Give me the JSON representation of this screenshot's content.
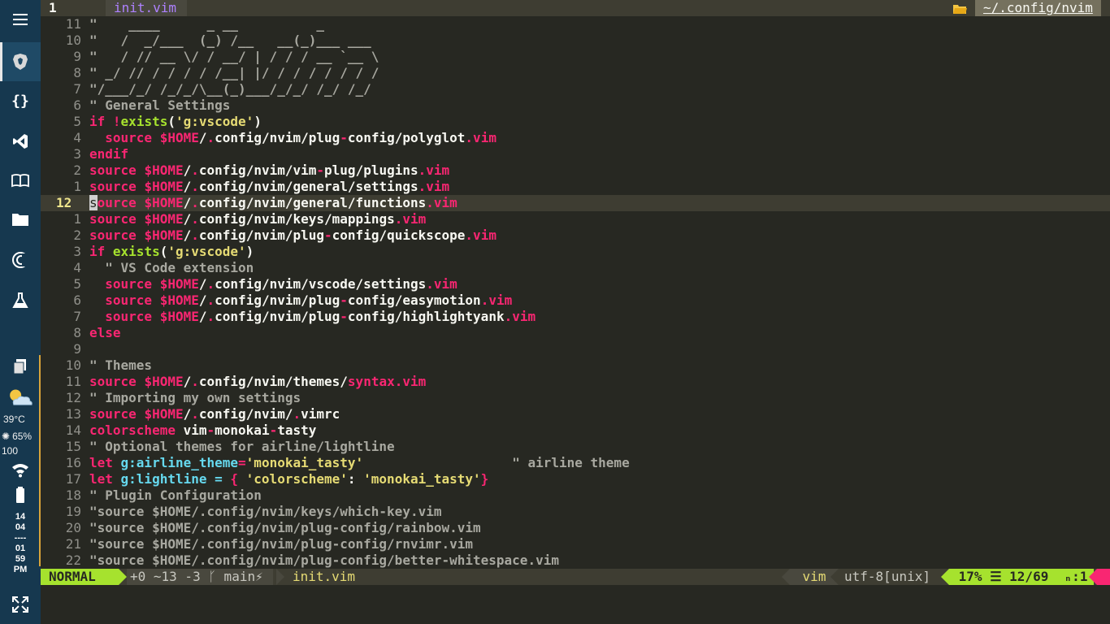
{
  "dock": {
    "weather_temp": "39°C",
    "brightness": "65%",
    "volume": "100",
    "clock": [
      "14",
      "04",
      "----",
      "01",
      "59",
      "PM"
    ]
  },
  "tabline": {
    "tab_number": "1",
    "active_tab": "init.vim",
    "cwd": "~/.config/nvim"
  },
  "buffer": {
    "lines": [
      {
        "n": "11",
        "segs": [
          [
            "c",
            "\"    ____      _ __          _"
          ]
        ]
      },
      {
        "n": "10",
        "segs": [
          [
            "c",
            "\"   /  _/___  (_) /__   __(_)___ ___"
          ]
        ]
      },
      {
        "n": "9",
        "segs": [
          [
            "c",
            "\"   / // __ \\/ / __/ | / / / __ `__ \\"
          ]
        ]
      },
      {
        "n": "8",
        "segs": [
          [
            "c",
            "\" _/ // / / / / /__| |/ / / / / / / /"
          ]
        ]
      },
      {
        "n": "7",
        "segs": [
          [
            "c",
            "\"/___/_/ /_/_/\\__(_)___/_/_/ /_/ /_/"
          ]
        ]
      },
      {
        "n": "6",
        "segs": [
          [
            "c",
            "\" General Settings"
          ]
        ]
      },
      {
        "n": "5",
        "segs": [
          [
            "k",
            "if "
          ],
          [
            "k",
            "!"
          ],
          [
            "fn",
            "exists"
          ],
          [
            "w",
            "("
          ],
          [
            "s",
            "'g:vscode'"
          ],
          [
            "w",
            ")"
          ]
        ]
      },
      {
        "n": "4",
        "segs": [
          [
            "k",
            "  source "
          ],
          [
            "v",
            "$HOME"
          ],
          [
            "p",
            "/"
          ],
          [
            "k",
            "."
          ],
          [
            "p",
            "config/nvim/plug"
          ],
          [
            "k",
            "-"
          ],
          [
            "p",
            "config/polyglot"
          ],
          [
            "k",
            ".vim"
          ]
        ]
      },
      {
        "n": "3",
        "segs": [
          [
            "k",
            "endif"
          ]
        ]
      },
      {
        "n": "2",
        "segs": [
          [
            "k",
            "source "
          ],
          [
            "v",
            "$HOME"
          ],
          [
            "p",
            "/"
          ],
          [
            "k",
            "."
          ],
          [
            "p",
            "config/nvim/vim"
          ],
          [
            "k",
            "-"
          ],
          [
            "p",
            "plug/plugins"
          ],
          [
            "k",
            ".vim"
          ]
        ]
      },
      {
        "n": "1",
        "segs": [
          [
            "k",
            "source "
          ],
          [
            "v",
            "$HOME"
          ],
          [
            "p",
            "/"
          ],
          [
            "k",
            "."
          ],
          [
            "p",
            "config/nvim/general/settings"
          ],
          [
            "k",
            ".vim"
          ]
        ]
      },
      {
        "n": "12",
        "cur": true,
        "segs": [
          [
            "cursor",
            "s"
          ],
          [
            "k",
            "ource "
          ],
          [
            "v",
            "$HOME"
          ],
          [
            "p",
            "/"
          ],
          [
            "k",
            "."
          ],
          [
            "p",
            "config/nvim/general/functions"
          ],
          [
            "k",
            ".vim"
          ]
        ]
      },
      {
        "n": "1",
        "segs": [
          [
            "k",
            "source "
          ],
          [
            "v",
            "$HOME"
          ],
          [
            "p",
            "/"
          ],
          [
            "k",
            "."
          ],
          [
            "p",
            "config/nvim/keys/mappings"
          ],
          [
            "k",
            ".vim"
          ]
        ]
      },
      {
        "n": "2",
        "segs": [
          [
            "k",
            "source "
          ],
          [
            "v",
            "$HOME"
          ],
          [
            "p",
            "/"
          ],
          [
            "k",
            "."
          ],
          [
            "p",
            "config/nvim/plug"
          ],
          [
            "k",
            "-"
          ],
          [
            "p",
            "config/quickscope"
          ],
          [
            "k",
            ".vim"
          ]
        ]
      },
      {
        "n": "3",
        "segs": [
          [
            "k",
            "if "
          ],
          [
            "fn",
            "exists"
          ],
          [
            "w",
            "("
          ],
          [
            "s",
            "'g:vscode'"
          ],
          [
            "w",
            ")"
          ]
        ]
      },
      {
        "n": "4",
        "segs": [
          [
            "c",
            "  \" VS Code extension"
          ]
        ]
      },
      {
        "n": "5",
        "segs": [
          [
            "k",
            "  source "
          ],
          [
            "v",
            "$HOME"
          ],
          [
            "p",
            "/"
          ],
          [
            "k",
            "."
          ],
          [
            "p",
            "config/nvim/vscode/settings"
          ],
          [
            "k",
            ".vim"
          ]
        ]
      },
      {
        "n": "6",
        "segs": [
          [
            "k",
            "  source "
          ],
          [
            "v",
            "$HOME"
          ],
          [
            "p",
            "/"
          ],
          [
            "k",
            "."
          ],
          [
            "p",
            "config/nvim/plug"
          ],
          [
            "k",
            "-"
          ],
          [
            "p",
            "config/easymotion"
          ],
          [
            "k",
            ".vim"
          ]
        ]
      },
      {
        "n": "7",
        "segs": [
          [
            "k",
            "  source "
          ],
          [
            "v",
            "$HOME"
          ],
          [
            "p",
            "/"
          ],
          [
            "k",
            "."
          ],
          [
            "p",
            "config/nvim/plug"
          ],
          [
            "k",
            "-"
          ],
          [
            "p",
            "config/highlightyank"
          ],
          [
            "k",
            ".vim"
          ]
        ]
      },
      {
        "n": "8",
        "segs": [
          [
            "k",
            "else"
          ]
        ]
      },
      {
        "n": "9",
        "segs": []
      },
      {
        "n": "10",
        "segs": [
          [
            "c",
            "\" Themes"
          ]
        ]
      },
      {
        "n": "11",
        "segs": [
          [
            "k",
            "source "
          ],
          [
            "v",
            "$HOME"
          ],
          [
            "p",
            "/"
          ],
          [
            "k",
            "."
          ],
          [
            "p",
            "config/nvim/themes/"
          ],
          [
            "k",
            "syntax.vim"
          ]
        ]
      },
      {
        "n": "12",
        "segs": [
          [
            "c",
            "\" Importing my own settings"
          ]
        ]
      },
      {
        "n": "13",
        "segs": [
          [
            "k",
            "source "
          ],
          [
            "v",
            "$HOME"
          ],
          [
            "p",
            "/"
          ],
          [
            "k",
            "."
          ],
          [
            "p",
            "config/nvim/"
          ],
          [
            "k",
            "."
          ],
          [
            "p",
            "vimrc"
          ]
        ]
      },
      {
        "n": "14",
        "segs": [
          [
            "k",
            "colorscheme "
          ],
          [
            "p",
            "vim"
          ],
          [
            "k",
            "-"
          ],
          [
            "p",
            "monokai"
          ],
          [
            "k",
            "-"
          ],
          [
            "p",
            "tasty"
          ]
        ]
      },
      {
        "n": "15",
        "segs": [
          [
            "c",
            "\" Optional themes for airline/lightline"
          ]
        ]
      },
      {
        "n": "16",
        "segs": [
          [
            "k",
            "let "
          ],
          [
            "g",
            "g:airline_theme"
          ],
          [
            "k",
            "="
          ],
          [
            "s",
            "'monokai_tasty'"
          ],
          [
            "w",
            "                   "
          ],
          [
            "c",
            "\" airline theme"
          ]
        ]
      },
      {
        "n": "17",
        "segs": [
          [
            "k",
            "let "
          ],
          [
            "g",
            "g:lightline = "
          ],
          [
            "k",
            "{ "
          ],
          [
            "s",
            "'colorscheme'"
          ],
          [
            "w",
            ": "
          ],
          [
            "s",
            "'monokai_tasty'"
          ],
          [
            "k",
            "}"
          ]
        ]
      },
      {
        "n": "18",
        "segs": [
          [
            "c",
            "\" Plugin Configuration"
          ]
        ]
      },
      {
        "n": "19",
        "segs": [
          [
            "c",
            "\"source $HOME/.config/nvim/keys/which-key.vim"
          ]
        ]
      },
      {
        "n": "20",
        "segs": [
          [
            "c",
            "\"source $HOME/.config/nvim/plug-config/rainbow.vim"
          ]
        ]
      },
      {
        "n": "21",
        "segs": [
          [
            "c",
            "\"source $HOME/.config/nvim/plug-config/rnvimr.vim"
          ]
        ]
      },
      {
        "n": "22",
        "segs": [
          [
            "c",
            "\"source $HOME/.config/nvim/plug-config/better-whitespace.vim"
          ]
        ]
      }
    ]
  },
  "statusline": {
    "mode": "NORMAL",
    "git": "+0 ~13 -3 ᚴ main⚡",
    "filename": "init.vim",
    "filetype": "vim",
    "encoding": "utf-8[unix]",
    "position": "17% ☰ 12/69",
    "column": "ₙ:1"
  },
  "colors": {
    "background": "#272822",
    "keyword": "#f92672",
    "string": "#e6db74",
    "function": "#a6e22e",
    "comment": "#a8a8a0",
    "dock": "#16384f"
  }
}
